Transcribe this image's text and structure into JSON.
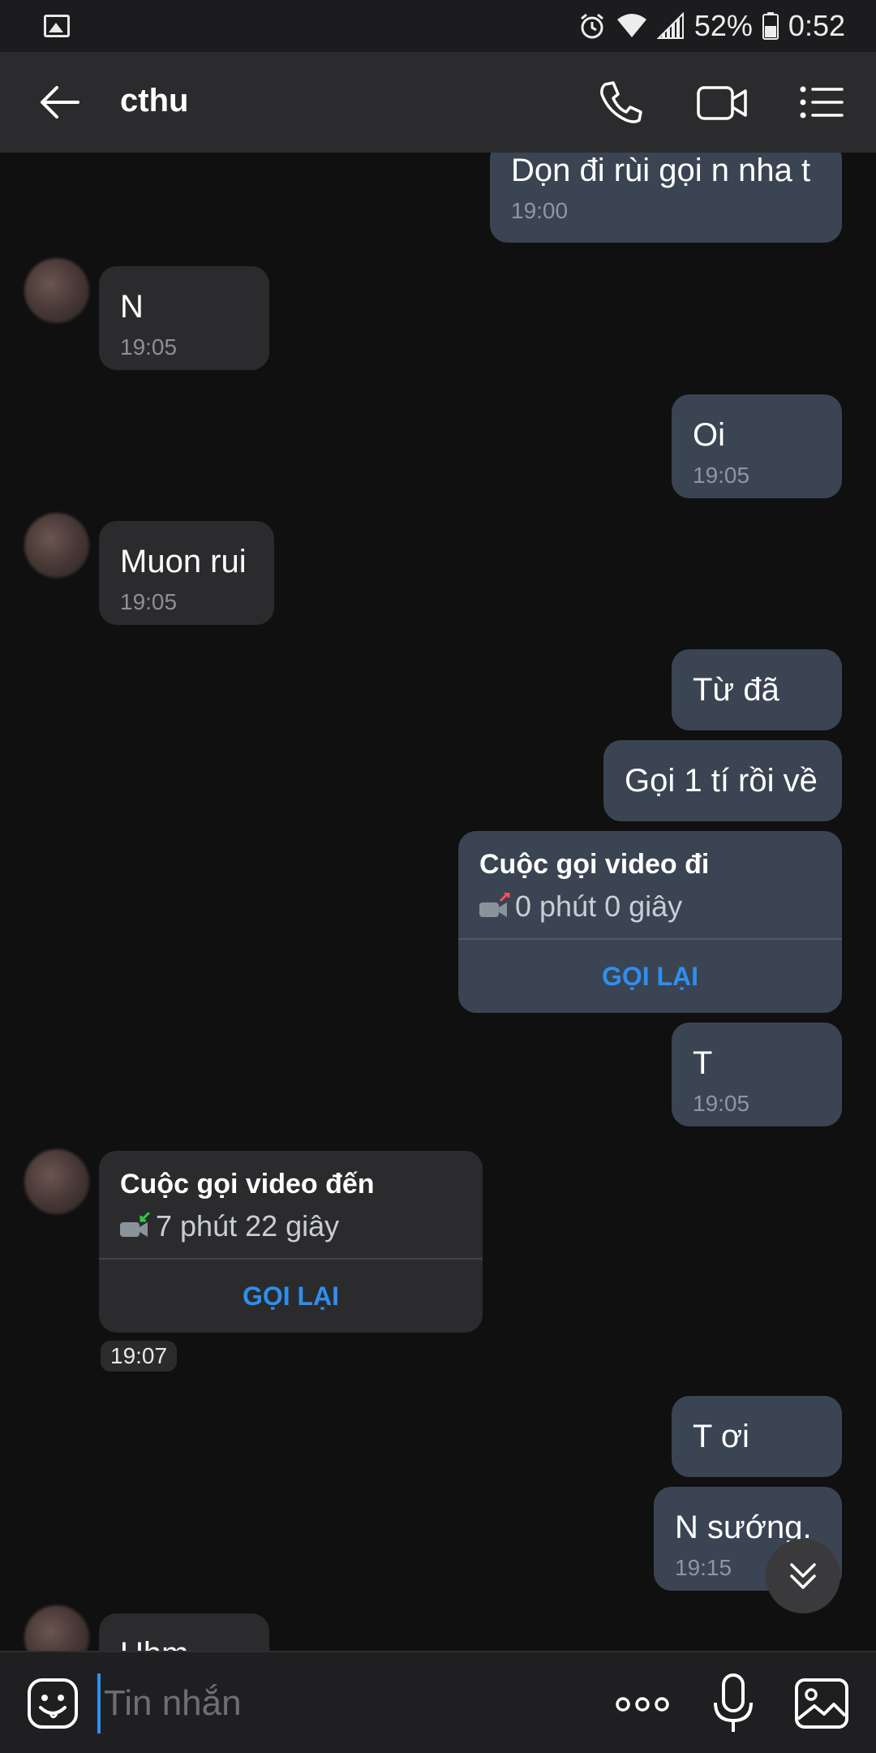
{
  "status_bar": {
    "battery_percent": "52%",
    "time": "0:52",
    "icons": [
      "image-icon",
      "alarm-icon",
      "wifi-icon",
      "signal-icon",
      "battery-icon"
    ]
  },
  "header": {
    "title": "cthu",
    "icons": [
      "back-arrow-icon",
      "phone-icon",
      "video-camera-icon",
      "menu-list-icon"
    ]
  },
  "messages": [
    {
      "dir": "out",
      "text": "Dọn đi rùi gọi n nha t",
      "time": "19:00"
    },
    {
      "dir": "in",
      "text": "N",
      "time": "19:05"
    },
    {
      "dir": "out",
      "text": "Oi",
      "time": "19:05"
    },
    {
      "dir": "in",
      "text": "Muon rui",
      "time": "19:05"
    },
    {
      "dir": "out",
      "text": "Từ đã"
    },
    {
      "dir": "out",
      "text": "Gọi 1 tí rồi về"
    },
    {
      "dir": "out",
      "type": "call",
      "title": "Cuộc gọi video đi",
      "duration": "0 phút 0 giây",
      "action": "GỌI LẠI"
    },
    {
      "dir": "out",
      "text": "T",
      "time": "19:05"
    },
    {
      "dir": "in",
      "type": "call",
      "title": "Cuộc gọi video đến",
      "duration": "7 phút 22 giây",
      "action": "GỌI LẠI",
      "time": "19:07"
    },
    {
      "dir": "out",
      "text": "T ơi"
    },
    {
      "dir": "out",
      "text": "N sướng.",
      "time": "19:15"
    },
    {
      "dir": "in",
      "text": "Uhm"
    }
  ],
  "input_bar": {
    "placeholder": "Tin nhắn"
  },
  "colors": {
    "background": "#101010",
    "header": "#2b2b2d",
    "outgoing_bubble": "#3a4452",
    "incoming_bubble": "#2b2b2d",
    "accent": "#2d8ff0",
    "outgoing_call_arrow": "#ff4d5a",
    "incoming_call_arrow": "#2ecc40"
  }
}
